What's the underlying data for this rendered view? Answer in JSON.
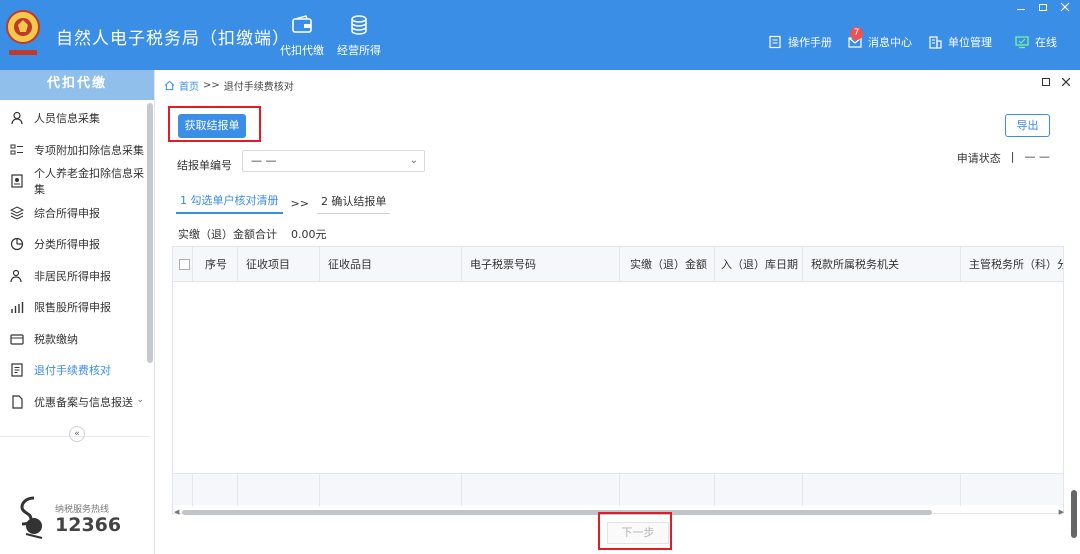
{
  "app": {
    "title": "自然人电子税务局（扣缴端）",
    "accent": "#3a8ee6"
  },
  "top_nav": [
    {
      "label": "代扣代缴",
      "icon": "wallet-icon"
    },
    {
      "label": "经营所得",
      "icon": "coins-icon"
    }
  ],
  "header_links": {
    "manual": "操作手册",
    "messages": "消息中心",
    "messages_count": "7",
    "units": "单位管理",
    "online": "在线"
  },
  "sidebar": {
    "title": "代扣代缴",
    "items": [
      {
        "label": "人员信息采集",
        "icon": "person-icon"
      },
      {
        "label": "专项附加扣除信息采集",
        "icon": "list-icon"
      },
      {
        "label": "个人养老金扣除信息采集",
        "icon": "id-card-icon"
      },
      {
        "label": "综合所得申报",
        "icon": "layers-icon"
      },
      {
        "label": "分类所得申报",
        "icon": "pie-icon"
      },
      {
        "label": "非居民所得申报",
        "icon": "user-swap-icon"
      },
      {
        "label": "限售股所得申报",
        "icon": "bar-chart-icon"
      },
      {
        "label": "税款缴纳",
        "icon": "folder-icon"
      },
      {
        "label": "退付手续费核对",
        "icon": "document-icon",
        "active": true
      },
      {
        "label": "优惠备案与信息报送",
        "icon": "file-icon"
      }
    ],
    "hotline_label": "纳税服务热线",
    "hotline_number": "12366"
  },
  "breadcrumb": {
    "home": "首页",
    "separator": ">>",
    "current": "退付手续费核对"
  },
  "toolbar": {
    "get_report": "获取结报单",
    "export": "导出"
  },
  "form": {
    "report_no_label": "结报单编号",
    "report_no_value": "— —",
    "status_label": "申请状态",
    "status_sep": "|",
    "status_value": "— —"
  },
  "steps": {
    "step1": "1 勾选单户核对清册",
    "separator": ">>",
    "step2": "2 确认结报单"
  },
  "total": {
    "label": "实缴（退）金额合计",
    "value": "0.00元"
  },
  "table": {
    "headers": [
      "序号",
      "征收项目",
      "征收品目",
      "电子税票号码",
      "实缴（退）金额",
      "入（退）库日期",
      "税款所属税务机关",
      "主管税务所（科）分"
    ]
  },
  "footer": {
    "next": "下一步"
  }
}
